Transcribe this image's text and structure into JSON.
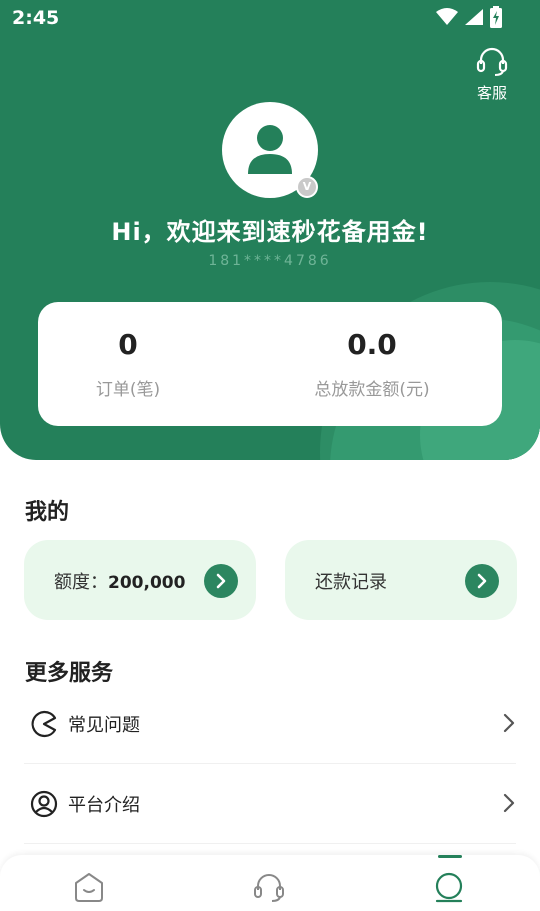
{
  "status_bar": {
    "time": "2:45"
  },
  "header": {
    "service_label": "客服",
    "greeting": "Hi，欢迎来到速秒花备用金!",
    "phone": "181****4786",
    "badge": "V"
  },
  "stats": {
    "orders_value": "0",
    "orders_label": "订单(笔)",
    "loan_value": "0.0",
    "loan_label": "总放款金额(元)"
  },
  "mine": {
    "title": "我的",
    "limit_label": "额度：",
    "limit_value": "200,000",
    "repay_label": "还款记录"
  },
  "more": {
    "title": "更多服务",
    "items": [
      {
        "label": "常见问题",
        "icon": "faq-icon"
      },
      {
        "label": "平台介绍",
        "icon": "user-circle-icon"
      }
    ]
  },
  "tabs": [
    {
      "name": "home",
      "icon": "home-icon"
    },
    {
      "name": "service",
      "icon": "headset-icon"
    },
    {
      "name": "mine",
      "icon": "profile-icon",
      "active": true
    }
  ],
  "colors": {
    "brand": "#24805a",
    "card_bg": "#e9f8ec"
  }
}
